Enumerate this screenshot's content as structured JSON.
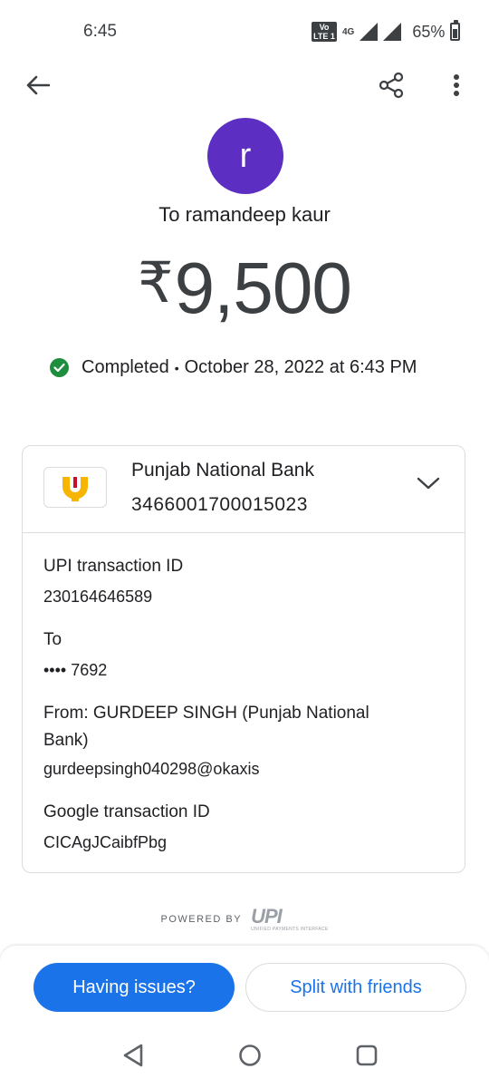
{
  "status_bar": {
    "time": "6:45",
    "volte_top": "Vo",
    "volte_bottom": "LTE 1",
    "network": "4G",
    "battery": "65%"
  },
  "top_bar": {
    "back_icon": "arrow-left-icon",
    "share_icon": "share-icon",
    "more_icon": "more-vert-icon"
  },
  "payee": {
    "avatar_letter": "r",
    "avatar_color": "#5c2fc2",
    "label": "To ramandeep kaur"
  },
  "payment": {
    "currency": "₹",
    "amount": "9,500",
    "status": "Completed",
    "separator": "•",
    "datetime": "October 28, 2022 at 6:43 PM",
    "status_color": "#1e8e3e"
  },
  "bank": {
    "name": "Punjab National Bank",
    "account": "3466001700015023",
    "logo_color": "#f5b500"
  },
  "details": {
    "upi_id_label": "UPI transaction ID",
    "upi_id_value": "230164646589",
    "to_label": "To",
    "to_value": "•••• 7692",
    "from_label": "From: GURDEEP SINGH (Punjab National",
    "from_label_2": "Bank)",
    "from_value": "gurdeepsingh040298@okaxis",
    "google_id_label": "Google transaction ID",
    "google_id_value": "CICAgJCaibfPbg"
  },
  "footer": {
    "powered_by": "POWERED BY",
    "upi": "UPI",
    "upi_sub": "UNIFIED PAYMENTS INTERFACE"
  },
  "actions": {
    "having_issues": "Having issues?",
    "split": "Split with friends",
    "accent": "#1a73e8"
  },
  "nav_bar": {
    "back": "triangle-back-icon",
    "home": "circle-home-icon",
    "recents": "square-recents-icon"
  }
}
